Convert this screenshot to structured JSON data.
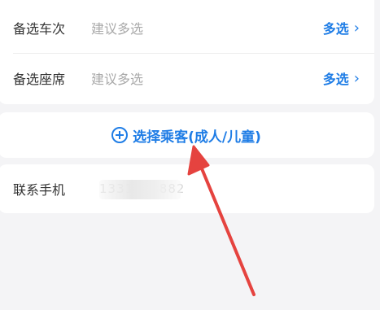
{
  "options": {
    "backup_trains": {
      "label": "备选车次",
      "hint": "建议多选",
      "action": "多选",
      "chevron": "›"
    },
    "backup_seats": {
      "label": "备选座席",
      "hint": "建议多选",
      "action": "多选",
      "chevron": "›"
    }
  },
  "passenger": {
    "add_label": "选择乘客(成人/儿童)",
    "icon": "plus-circle-icon"
  },
  "contact": {
    "label": "联系手机",
    "value": "1331888882"
  },
  "colors": {
    "accent": "#1f7de6",
    "arrow": "#e5433f",
    "background": "#f4f4f6"
  }
}
